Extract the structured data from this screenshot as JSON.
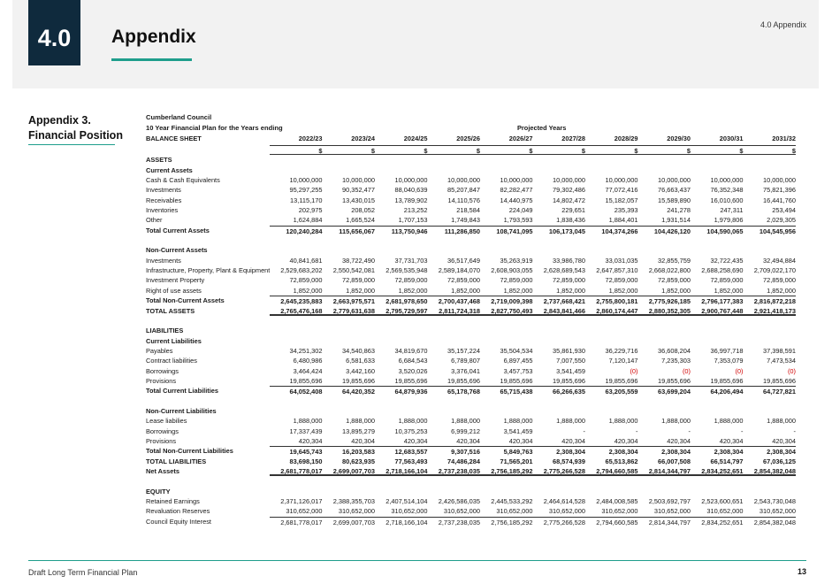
{
  "header": {
    "section_number": "4.0",
    "title": "Appendix",
    "right_label": "4.0 Appendix"
  },
  "sidebar": {
    "line1": "Appendix 3.",
    "line2": "Financial Position"
  },
  "table": {
    "council": "Cumberland Council",
    "plan": "10 Year Financial Plan for the Years ending",
    "sheet": "BALANCE SHEET",
    "projected_label": "Projected Years",
    "years": [
      "2022/23",
      "2023/24",
      "2024/25",
      "2025/26",
      "2026/27",
      "2027/28",
      "2028/29",
      "2029/30",
      "2030/31",
      "2031/32"
    ],
    "currency": "$",
    "rows": [
      {
        "label": "ASSETS",
        "style": "heading",
        "values": []
      },
      {
        "label": "Current Assets",
        "style": "heading",
        "values": []
      },
      {
        "label": "Cash & Cash Equivalents",
        "values": [
          "10,000,000",
          "10,000,000",
          "10,000,000",
          "10,000,000",
          "10,000,000",
          "10,000,000",
          "10,000,000",
          "10,000,000",
          "10,000,000",
          "10,000,000"
        ]
      },
      {
        "label": "Investments",
        "values": [
          "95,297,255",
          "90,352,477",
          "88,040,639",
          "85,207,847",
          "82,282,477",
          "79,302,486",
          "77,072,416",
          "76,663,437",
          "76,352,348",
          "75,821,396"
        ]
      },
      {
        "label": "Receivables",
        "values": [
          "13,115,170",
          "13,430,015",
          "13,789,902",
          "14,110,576",
          "14,440,975",
          "14,802,472",
          "15,182,057",
          "15,589,890",
          "16,010,600",
          "16,441,760"
        ]
      },
      {
        "label": "Inventories",
        "values": [
          "202,975",
          "208,052",
          "213,252",
          "218,584",
          "224,049",
          "229,651",
          "235,393",
          "241,278",
          "247,311",
          "253,494"
        ]
      },
      {
        "label": "Other",
        "values": [
          "1,624,884",
          "1,665,524",
          "1,707,153",
          "1,749,843",
          "1,793,593",
          "1,838,436",
          "1,884,401",
          "1,931,514",
          "1,979,806",
          "2,029,305"
        ]
      },
      {
        "label": "Total Current Assets",
        "style": "bold total",
        "values": [
          "120,240,284",
          "115,656,067",
          "113,750,946",
          "111,286,850",
          "108,741,095",
          "106,173,045",
          "104,374,266",
          "104,426,120",
          "104,590,065",
          "104,545,956"
        ]
      },
      {
        "label": "",
        "style": "spacer",
        "values": []
      },
      {
        "label": "Non-Current Assets",
        "style": "heading",
        "values": []
      },
      {
        "label": "Investments",
        "values": [
          "40,841,681",
          "38,722,490",
          "37,731,703",
          "36,517,649",
          "35,263,919",
          "33,986,780",
          "33,031,035",
          "32,855,759",
          "32,722,435",
          "32,494,884"
        ]
      },
      {
        "label": "Infrastructure, Property, Plant & Equipment",
        "values": [
          "2,529,683,202",
          "2,550,542,081",
          "2,569,535,948",
          "2,589,184,070",
          "2,608,903,055",
          "2,628,689,543",
          "2,647,857,310",
          "2,668,022,800",
          "2,688,258,690",
          "2,709,022,170"
        ]
      },
      {
        "label": "Investment Property",
        "values": [
          "72,859,000",
          "72,859,000",
          "72,859,000",
          "72,859,000",
          "72,859,000",
          "72,859,000",
          "72,859,000",
          "72,859,000",
          "72,859,000",
          "72,859,000"
        ]
      },
      {
        "label": "Right of use assets",
        "values": [
          "1,852,000",
          "1,852,000",
          "1,852,000",
          "1,852,000",
          "1,852,000",
          "1,852,000",
          "1,852,000",
          "1,852,000",
          "1,852,000",
          "1,852,000"
        ]
      },
      {
        "label": "Total Non-Current Assets",
        "style": "bold total",
        "values": [
          "2,645,235,883",
          "2,663,975,571",
          "2,681,978,650",
          "2,700,437,468",
          "2,719,009,398",
          "2,737,668,421",
          "2,755,800,181",
          "2,775,926,185",
          "2,796,177,383",
          "2,816,872,218"
        ]
      },
      {
        "label": "TOTAL ASSETS",
        "style": "bold double",
        "values": [
          "2,765,476,168",
          "2,779,631,638",
          "2,795,729,597",
          "2,811,724,318",
          "2,827,750,493",
          "2,843,841,466",
          "2,860,174,447",
          "2,880,352,305",
          "2,900,767,448",
          "2,921,418,173"
        ]
      },
      {
        "label": "",
        "style": "spacer",
        "values": []
      },
      {
        "label": "LIABILITIES",
        "style": "heading",
        "values": []
      },
      {
        "label": "Current Liabilities",
        "style": "heading",
        "values": []
      },
      {
        "label": "Payables",
        "values": [
          "34,251,302",
          "34,540,863",
          "34,819,670",
          "35,157,224",
          "35,504,534",
          "35,861,930",
          "36,229,716",
          "36,608,204",
          "36,997,718",
          "37,398,591"
        ]
      },
      {
        "label": "Contract liabilities",
        "values": [
          "6,480,986",
          "6,581,633",
          "6,684,543",
          "6,789,807",
          "6,897,455",
          "7,007,550",
          "7,120,147",
          "7,235,303",
          "7,353,079",
          "7,473,534"
        ]
      },
      {
        "label": "Borrowings",
        "values": [
          "3,464,424",
          "3,442,160",
          "3,520,026",
          "3,376,041",
          "3,457,753",
          "3,541,459",
          "(0)",
          "(0)",
          "(0)",
          "(0)"
        ]
      },
      {
        "label": "Provisions",
        "values": [
          "19,855,696",
          "19,855,696",
          "19,855,696",
          "19,855,696",
          "19,855,696",
          "19,855,696",
          "19,855,696",
          "19,855,696",
          "19,855,696",
          "19,855,696"
        ]
      },
      {
        "label": "Total Current Liabilities",
        "style": "bold total",
        "values": [
          "64,052,408",
          "64,420,352",
          "64,879,936",
          "65,178,768",
          "65,715,438",
          "66,266,635",
          "63,205,559",
          "63,699,204",
          "64,206,494",
          "64,727,821"
        ]
      },
      {
        "label": "",
        "style": "spacer",
        "values": []
      },
      {
        "label": "Non-Current Liabilities",
        "style": "heading",
        "values": []
      },
      {
        "label": "Lease liabilies",
        "values": [
          "1,888,000",
          "1,888,000",
          "1,888,000",
          "1,888,000",
          "1,888,000",
          "1,888,000",
          "1,888,000",
          "1,888,000",
          "1,888,000",
          "1,888,000"
        ]
      },
      {
        "label": "Borrowings",
        "values": [
          "17,337,439",
          "13,895,279",
          "10,375,253",
          "6,999,212",
          "3,541,459",
          "-",
          "-",
          "-",
          "-",
          "-"
        ]
      },
      {
        "label": "Provisions",
        "values": [
          "420,304",
          "420,304",
          "420,304",
          "420,304",
          "420,304",
          "420,304",
          "420,304",
          "420,304",
          "420,304",
          "420,304"
        ]
      },
      {
        "label": "Total Non-Current Liabilities",
        "style": "bold total",
        "values": [
          "19,645,743",
          "16,203,583",
          "12,683,557",
          "9,307,516",
          "5,849,763",
          "2,308,304",
          "2,308,304",
          "2,308,304",
          "2,308,304",
          "2,308,304"
        ]
      },
      {
        "label": "TOTAL LIABILITIES",
        "style": "bold",
        "values": [
          "83,698,150",
          "80,623,935",
          "77,563,493",
          "74,486,284",
          "71,565,201",
          "68,574,939",
          "65,513,862",
          "66,007,508",
          "66,514,797",
          "67,036,125"
        ]
      },
      {
        "label": "Net Assets",
        "style": "bold double",
        "values": [
          "2,681,778,017",
          "2,699,007,703",
          "2,718,166,104",
          "2,737,238,035",
          "2,756,185,292",
          "2,775,266,528",
          "2,794,660,585",
          "2,814,344,797",
          "2,834,252,651",
          "2,854,382,048"
        ]
      },
      {
        "label": "",
        "style": "spacer",
        "values": []
      },
      {
        "label": "EQUITY",
        "style": "heading",
        "values": []
      },
      {
        "label": "Retained Earnings",
        "values": [
          "2,371,126,017",
          "2,388,355,703",
          "2,407,514,104",
          "2,426,586,035",
          "2,445,533,292",
          "2,464,614,528",
          "2,484,008,585",
          "2,503,692,797",
          "2,523,600,651",
          "2,543,730,048"
        ]
      },
      {
        "label": "Revaluation Reserves",
        "values": [
          "310,652,000",
          "310,652,000",
          "310,652,000",
          "310,652,000",
          "310,652,000",
          "310,652,000",
          "310,652,000",
          "310,652,000",
          "310,652,000",
          "310,652,000"
        ]
      },
      {
        "label": "Council Equity Interest",
        "style": "total",
        "values": [
          "2,681,778,017",
          "2,699,007,703",
          "2,718,166,104",
          "2,737,238,035",
          "2,756,185,292",
          "2,775,266,528",
          "2,794,660,585",
          "2,814,344,797",
          "2,834,252,651",
          "2,854,382,048"
        ]
      }
    ]
  },
  "footer": {
    "left": "Draft Long Term Financial Plan",
    "page": "13"
  }
}
